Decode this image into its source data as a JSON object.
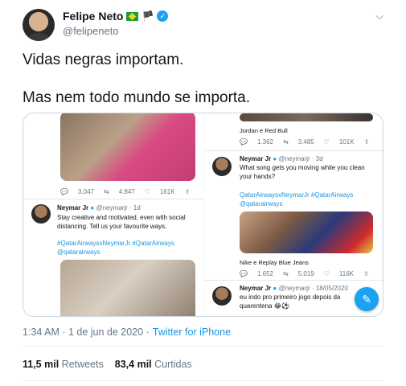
{
  "author": {
    "name": "Felipe Neto",
    "handle": "@felipeneto",
    "badge_flag_black": "🏴"
  },
  "tweet": {
    "line1": "Vidas negras importam.",
    "line2": "Mas nem todo mundo se importa."
  },
  "embedded": {
    "left": {
      "counts": [
        "3.047",
        "4.847",
        "161K"
      ],
      "post": {
        "name": "Neymar Jr",
        "handle": "@neymarjr · 1d",
        "text": "Stay creative and motivated, even with social distancing. Tell us your favourite ways.",
        "links": "#QatarAirwaysxNeymarJr #QatarAirways @qatarairways"
      }
    },
    "right": {
      "caption_top": "Jordan e Red Bull",
      "counts_top": [
        "1.362",
        "3.485",
        "101K"
      ],
      "post1": {
        "name": "Neymar Jr",
        "handle": "@neymarjr · 3d",
        "text": "What song gets you moving while you clean your hands?",
        "links": "QatarAirwaysxNeymarJr #QatarAirways @qatarairways"
      },
      "caption_mid": "Nike e Replay Blue Jeans",
      "counts_mid": [
        "1.652",
        "5.019",
        "116K"
      ],
      "post2": {
        "name": "Neymar Jr",
        "handle": "@neymarjr · 18/05/2020",
        "text": "eu indo pro primeiro jogo depois da quarentena 😂⚽"
      }
    }
  },
  "meta": {
    "time": "1:34 AM · 1 de jun de 2020 ·",
    "source": "Twitter for iPhone"
  },
  "stats": {
    "retweets_count": "11,5 mil",
    "retweets_label": "Retweets",
    "likes_count": "83,4 mil",
    "likes_label": "Curtidas"
  },
  "colors": {
    "accent": "#1da1f2",
    "text": "#14171a",
    "secondary": "#657786"
  }
}
